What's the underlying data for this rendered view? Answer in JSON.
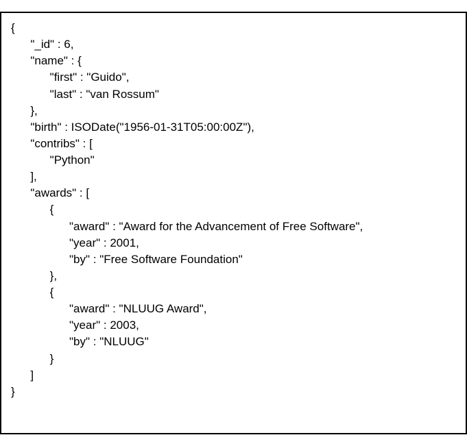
{
  "code_lines": [
    "{",
    "      \"_id\" : 6,",
    "      \"name\" : {",
    "            \"first\" : \"Guido\",",
    "            \"last\" : \"van Rossum\"",
    "      },",
    "      \"birth\" : ISODate(\"1956-01-31T05:00:00Z\"),",
    "      \"contribs\" : [",
    "            \"Python\"",
    "      ],",
    "      \"awards\" : [",
    "            {",
    "                  \"award\" : \"Award for the Advancement of Free Software\",",
    "                  \"year\" : 2001,",
    "                  \"by\" : \"Free Software Foundation\"",
    "            },",
    "            {",
    "                  \"award\" : \"NLUUG Award\",",
    "                  \"year\" : 2003,",
    "                  \"by\" : \"NLUUG\"",
    "            }",
    "      ]",
    "}"
  ],
  "document_data": {
    "_id": 6,
    "name": {
      "first": "Guido",
      "last": "van Rossum"
    },
    "birth": "ISODate(\"1956-01-31T05:00:00Z\")",
    "contribs": [
      "Python"
    ],
    "awards": [
      {
        "award": "Award for the Advancement of Free Software",
        "year": 2001,
        "by": "Free Software Foundation"
      },
      {
        "award": "NLUUG Award",
        "year": 2003,
        "by": "NLUUG"
      }
    ]
  }
}
